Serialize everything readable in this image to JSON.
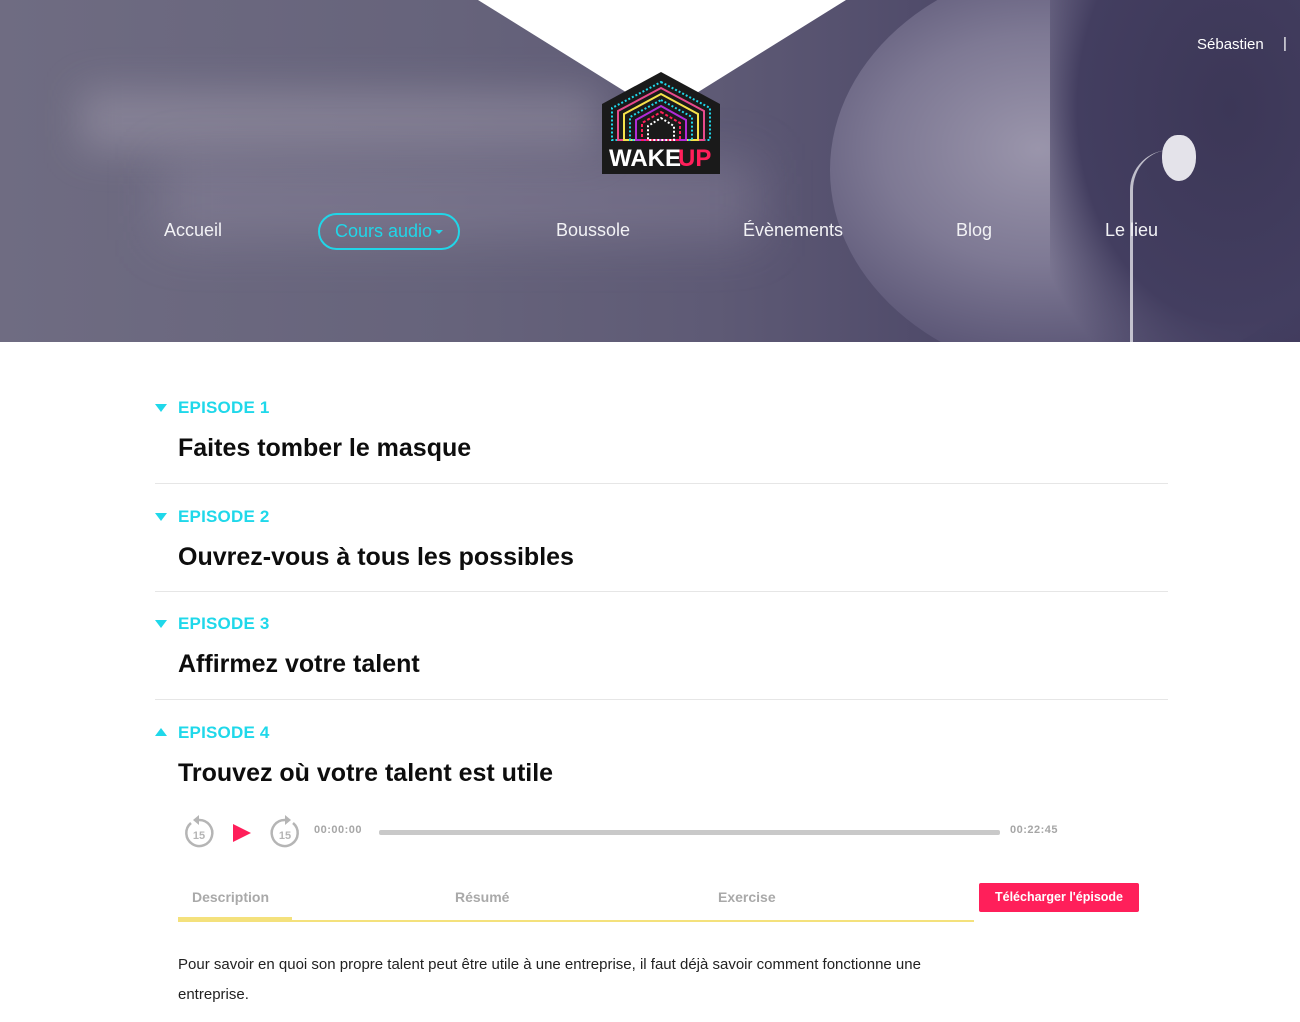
{
  "header": {
    "user_name": "Sébastien",
    "user_separator": "|",
    "logo_text_1": "WAKE",
    "logo_text_2": "UP"
  },
  "nav": {
    "items": [
      "Accueil",
      "Cours audio",
      "Boussole",
      "Évènements",
      "Blog",
      "Le lieu"
    ],
    "active_index": 1
  },
  "episodes": [
    {
      "label": "EPISODE 1",
      "title": "Faites tomber le masque",
      "expanded": false
    },
    {
      "label": "EPISODE 2",
      "title": "Ouvrez-vous à tous les possibles",
      "expanded": false
    },
    {
      "label": "EPISODE 3",
      "title": "Affirmez votre talent",
      "expanded": false
    },
    {
      "label": "EPISODE 4",
      "title": "Trouvez où votre talent est utile",
      "expanded": true
    }
  ],
  "player": {
    "current_time": "00:00:00",
    "total_time": "00:22:45",
    "skip_seconds": "15",
    "progress": 0
  },
  "tabs": {
    "items": [
      "Description",
      "Résumé",
      "Exercise"
    ],
    "active_index": 0,
    "download_label": "Télécharger l'épisode"
  },
  "description": "Pour savoir en quoi son propre talent peut être utile à une entreprise, il faut déjà savoir comment fonctionne une entreprise.",
  "colors": {
    "accent_cyan": "#1fd8ea",
    "accent_pink": "#ff1f5a",
    "tab_underline": "#f4e17c"
  }
}
